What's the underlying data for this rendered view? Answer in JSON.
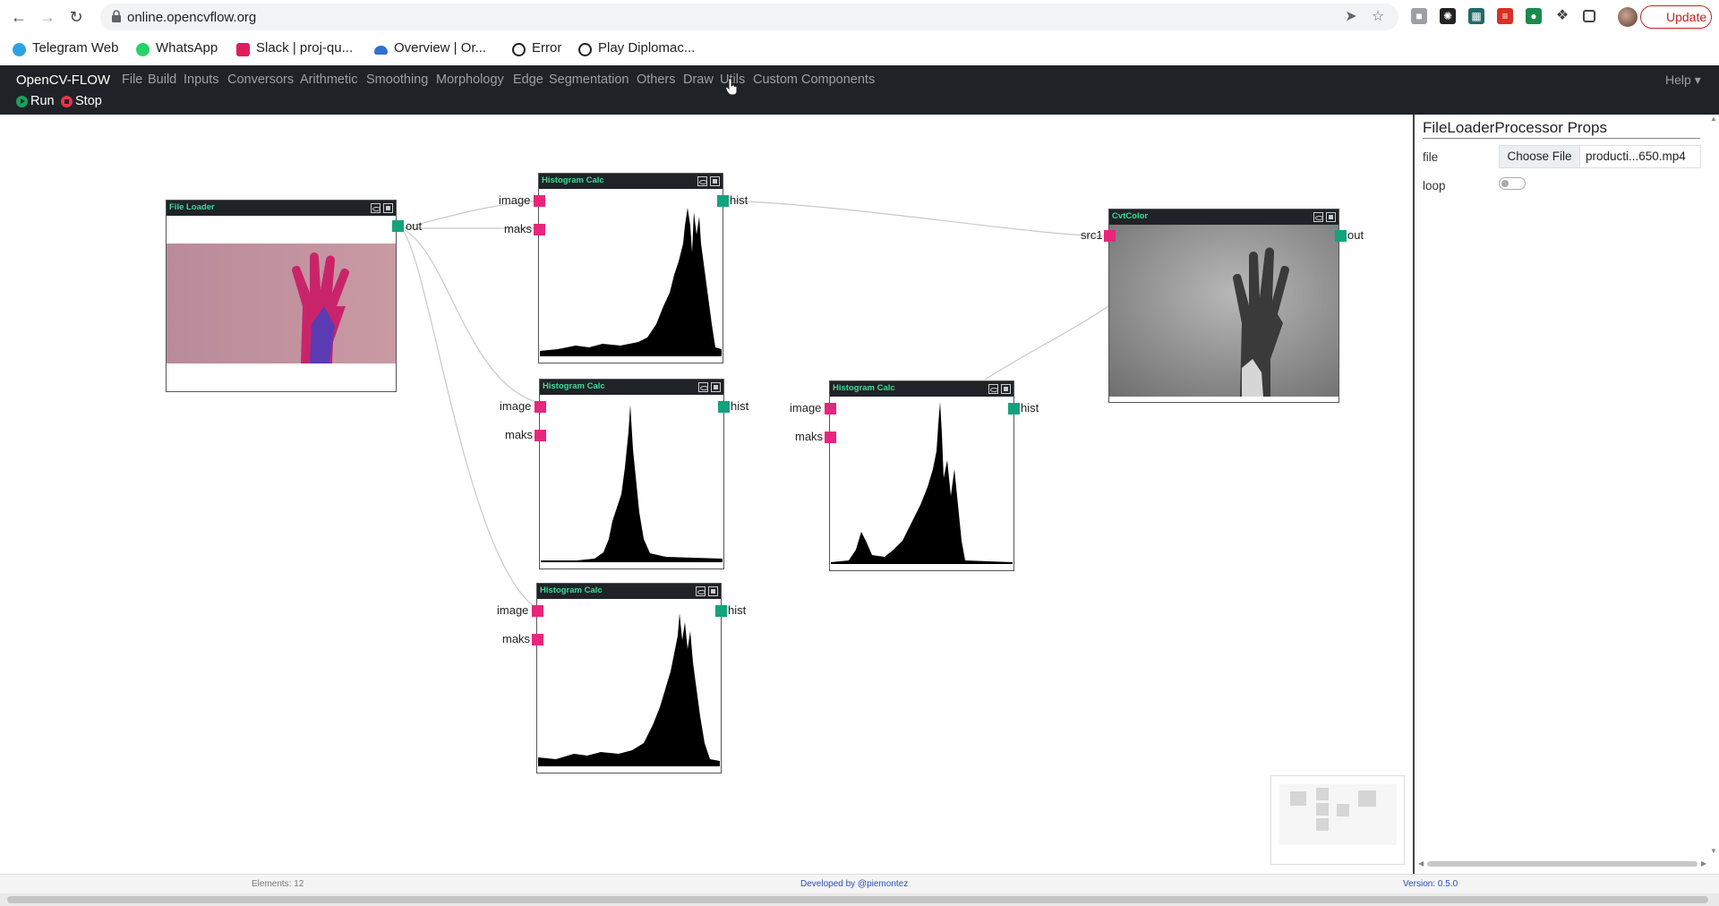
{
  "browser": {
    "url": "online.opencvflow.org",
    "update_label": "Update",
    "bookmarks": [
      {
        "label": "Telegram Web",
        "color": "#2aa3e2"
      },
      {
        "label": "WhatsApp",
        "color": "#25d366"
      },
      {
        "label": "Slack | proj-qu...",
        "color": "#e01e5a"
      },
      {
        "label": "Overview | Or...",
        "color": "#2f6fd1"
      },
      {
        "label": "Error",
        "color": "#202124"
      },
      {
        "label": "Play Diplomac...",
        "color": "#202124"
      }
    ]
  },
  "app": {
    "brand": "OpenCV-FLOW",
    "menu": [
      "File",
      "Build",
      "Inputs",
      "Conversors",
      "Arithmetic",
      "Smoothing",
      "Morphology",
      "Edge",
      "Segmentation",
      "Others",
      "Draw",
      "Utils",
      "Custom Components"
    ],
    "help": "Help",
    "run_label": "Run",
    "stop_label": "Stop",
    "colors": {
      "header": "#1f2327",
      "title": "#3ddc97",
      "in_port": "#e8267b",
      "out_port": "#12a37d"
    }
  },
  "nodes": {
    "file_loader": {
      "title": "File Loader",
      "out": "out"
    },
    "hist1": {
      "title": "Histogram Calc",
      "in1": "image",
      "in2": "maks",
      "out": "hist"
    },
    "hist2": {
      "title": "Histogram Calc",
      "in1": "image",
      "in2": "maks",
      "out": "hist"
    },
    "hist3": {
      "title": "Histogram Calc",
      "in1": "image",
      "in2": "maks",
      "out": "hist"
    },
    "hist4": {
      "title": "Histogram Calc",
      "in1": "image",
      "in2": "maks",
      "out": "hist"
    },
    "cvtcolor": {
      "title": "CvtColor",
      "in1": "src1",
      "out": "out"
    }
  },
  "props": {
    "title": "FileLoaderProcessor Props",
    "file_label": "file",
    "choose_file": "Choose File",
    "file_name": "producti...650.mp4",
    "loop_label": "loop",
    "loop_on": false
  },
  "footer": {
    "elements": "Elements: 12",
    "developed_by": "Developed by @piemontez",
    "version": "Version: 0.5.0"
  }
}
